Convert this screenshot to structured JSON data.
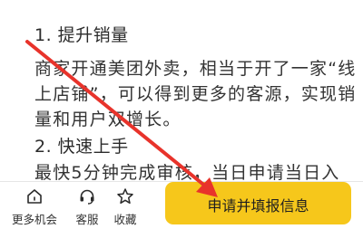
{
  "article": {
    "heading1": "1. 提升销量",
    "paragraph1_lines": [
      "商家开通美团外卖，相当于开了一家“线",
      "上店铺”，可以得到更多的客源，实现销",
      "量和用户双增长。"
    ],
    "heading2": "2. 快速上手",
    "paragraph2_line": "最快5分钟完成审核，当日申请当日入"
  },
  "bottom_bar": {
    "tabs": [
      {
        "label": "更多机会",
        "icon": "home-icon"
      },
      {
        "label": "客服",
        "icon": "headset-icon"
      },
      {
        "label": "收藏",
        "icon": "star-icon"
      }
    ],
    "primary_button": "申请并填报信息"
  },
  "colors": {
    "button_yellow": "#f6c71b",
    "annotation_arrow_red": "#e8332b",
    "text": "#333333"
  }
}
